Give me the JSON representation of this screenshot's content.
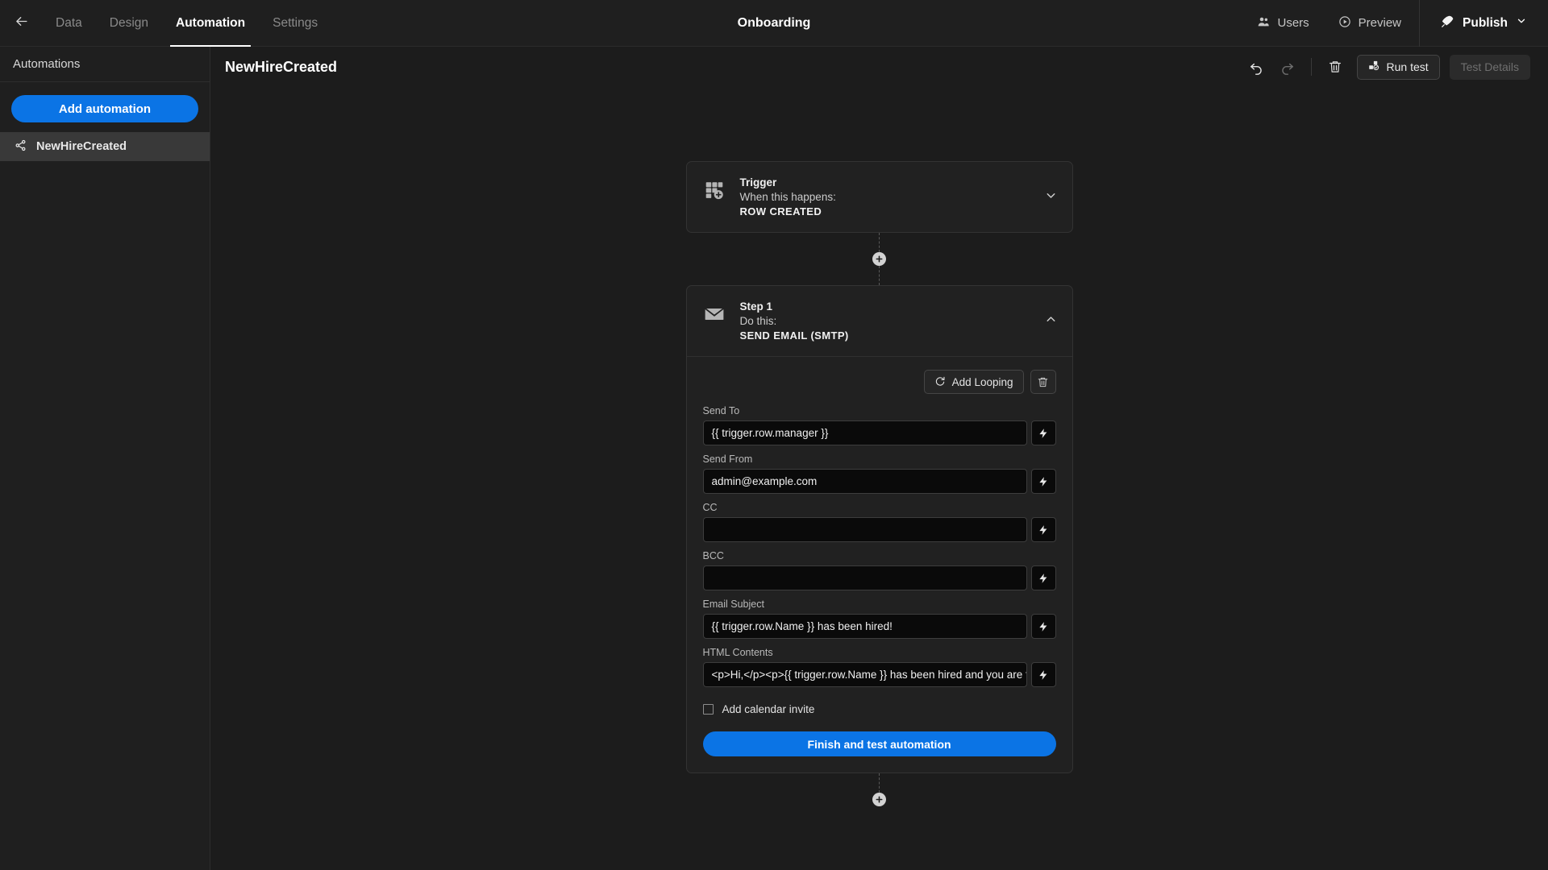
{
  "topbar": {
    "back_icon": "arrow-left-icon",
    "window_title": "Onboarding",
    "tabs": [
      {
        "label": "Data",
        "active": false
      },
      {
        "label": "Design",
        "active": false
      },
      {
        "label": "Automation",
        "active": true
      },
      {
        "label": "Settings",
        "active": false
      }
    ],
    "users_label": "Users",
    "preview_label": "Preview",
    "publish_label": "Publish"
  },
  "sidebar": {
    "header": "Automations",
    "add_button": "Add automation",
    "items": [
      {
        "label": "NewHireCreated",
        "selected": true
      }
    ]
  },
  "main_header": {
    "page_title": "NewHireCreated",
    "run_test_label": "Run test",
    "test_details_label": "Test Details"
  },
  "flow": {
    "trigger": {
      "kicker": "Trigger",
      "sub": "When this happens:",
      "action": "ROW CREATED"
    },
    "step": {
      "kicker": "Step 1",
      "sub": "Do this:",
      "action": "SEND EMAIL (SMTP)",
      "add_looping_label": "Add Looping",
      "fields": [
        {
          "label": "Send To",
          "value": "{{ trigger.row.manager }}"
        },
        {
          "label": "Send From",
          "value": "admin@example.com"
        },
        {
          "label": "CC",
          "value": ""
        },
        {
          "label": "BCC",
          "value": ""
        },
        {
          "label": "Email Subject",
          "value": "{{ trigger.row.Name }} has been hired!"
        },
        {
          "label": "HTML Contents",
          "value": "<p>Hi,</p><p>{{ trigger.row.Name }} has been hired and you are t…"
        }
      ],
      "calendar_invite_label": "Add calendar invite",
      "finish_label": "Finish and test automation"
    }
  },
  "colors": {
    "accent_blue": "#0b74e5",
    "canvas_bg": "#1c1c1c",
    "panel_bg": "#1f1f1f",
    "card_bg": "#212121",
    "input_bg": "#0a0a0a"
  }
}
